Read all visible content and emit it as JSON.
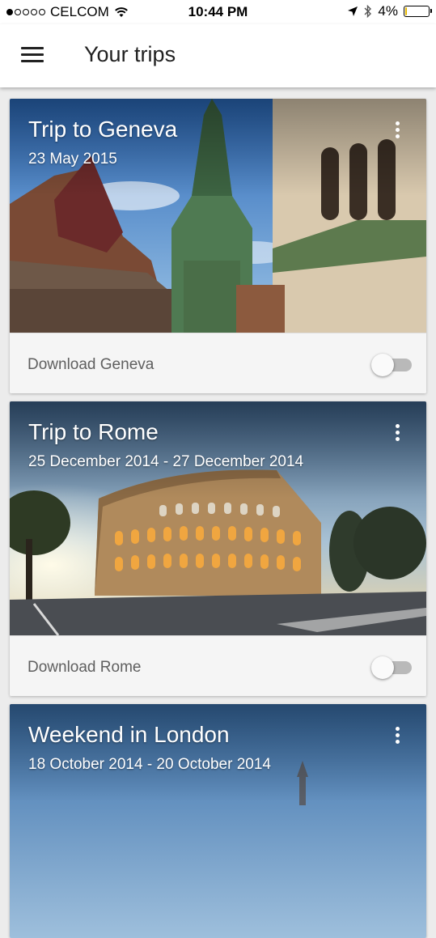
{
  "status_bar": {
    "carrier": "CELCOM",
    "time": "10:44 PM",
    "battery": "4%",
    "signal_bars_filled": 1,
    "signal_bars_total": 5,
    "battery_level": 0.04
  },
  "app_bar": {
    "title": "Your trips",
    "menu_icon": "hamburger-menu-icon"
  },
  "trips": [
    {
      "title": "Trip to Geneva",
      "dates": "23 May 2015",
      "download_label": "Download Geneva",
      "download_enabled": false,
      "image": "geneva-cathedral-photo"
    },
    {
      "title": "Trip to Rome",
      "dates": "25 December 2014 - 27 December 2014",
      "download_label": "Download Rome",
      "download_enabled": false,
      "image": "rome-colosseum-photo"
    },
    {
      "title": "Weekend in London",
      "dates": "18 October 2014 - 20 October 2014",
      "image": "london-skyline-photo"
    }
  ],
  "colors": {
    "app_bar_bg": "#ffffff",
    "page_bg": "#ececec",
    "card_footer_bg": "#f5f5f5",
    "battery_fill": "#e6b800"
  }
}
